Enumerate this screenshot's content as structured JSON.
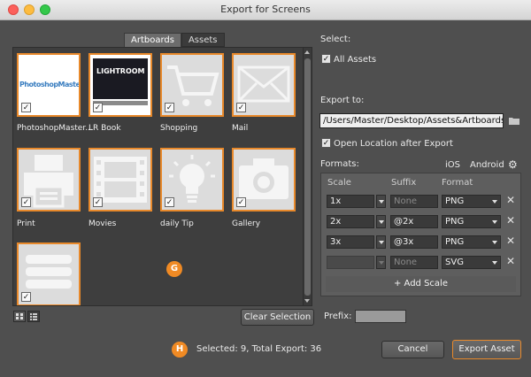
{
  "window": {
    "title": "Export for Screens"
  },
  "tabs": [
    {
      "label": "Artboards"
    },
    {
      "label": "Assets"
    }
  ],
  "artboards": [
    {
      "label": "PhotoshopMaster...",
      "checked": true,
      "icon": "photoshop-master-logo",
      "logo_text": "PhotoshopMaster"
    },
    {
      "label": "LR Book",
      "checked": true,
      "icon": "book-cover-icon",
      "logo_text": "LIGHTROOM"
    },
    {
      "label": "Shopping",
      "checked": true,
      "icon": "shopping-cart-icon"
    },
    {
      "label": "Mail",
      "checked": true,
      "icon": "envelope-icon"
    },
    {
      "label": "Print",
      "checked": true,
      "icon": "printer-icon"
    },
    {
      "label": "Movies",
      "checked": true,
      "icon": "film-strip-icon"
    },
    {
      "label": "daily Tip",
      "checked": true,
      "icon": "light-bulb-icon"
    },
    {
      "label": "Gallery",
      "checked": true,
      "icon": "camera-icon"
    },
    {
      "label": "",
      "checked": true,
      "icon": "server-stack-icon"
    }
  ],
  "badges": {
    "g": "G",
    "h": "H"
  },
  "buttons": {
    "clear_selection": "Clear Selection",
    "cancel": "Cancel",
    "export_asset": "Export Asset"
  },
  "select": {
    "label": "Select:",
    "all_assets": "All Assets",
    "all_assets_checked": true
  },
  "export_to": {
    "label": "Export to:",
    "path": "/Users/Master/Desktop/Assets&Artboards",
    "open_after_label": "Open Location after Export",
    "open_after_checked": true
  },
  "formats": {
    "label": "Formats:",
    "ios": "iOS",
    "android": "Android",
    "headers": {
      "scale": "Scale",
      "suffix": "Suffix",
      "format": "Format"
    },
    "rows": [
      {
        "scale": "1x",
        "suffix": "None",
        "suffix_placeholder": true,
        "format": "PNG",
        "disabled": false
      },
      {
        "scale": "2x",
        "suffix": "@2x",
        "suffix_placeholder": false,
        "format": "PNG",
        "disabled": false
      },
      {
        "scale": "3x",
        "suffix": "@3x",
        "suffix_placeholder": false,
        "format": "PNG",
        "disabled": false
      },
      {
        "scale": "",
        "suffix": "None",
        "suffix_placeholder": true,
        "format": "SVG",
        "disabled": true
      }
    ],
    "add_scale": "+ Add Scale",
    "remove_glyph": "✕"
  },
  "prefix": {
    "label": "Prefix:",
    "value": ""
  },
  "status": {
    "text": "Selected: 9, Total Export: 36"
  },
  "colors": {
    "accent": "#e8892b",
    "badge": "#f08a24"
  }
}
